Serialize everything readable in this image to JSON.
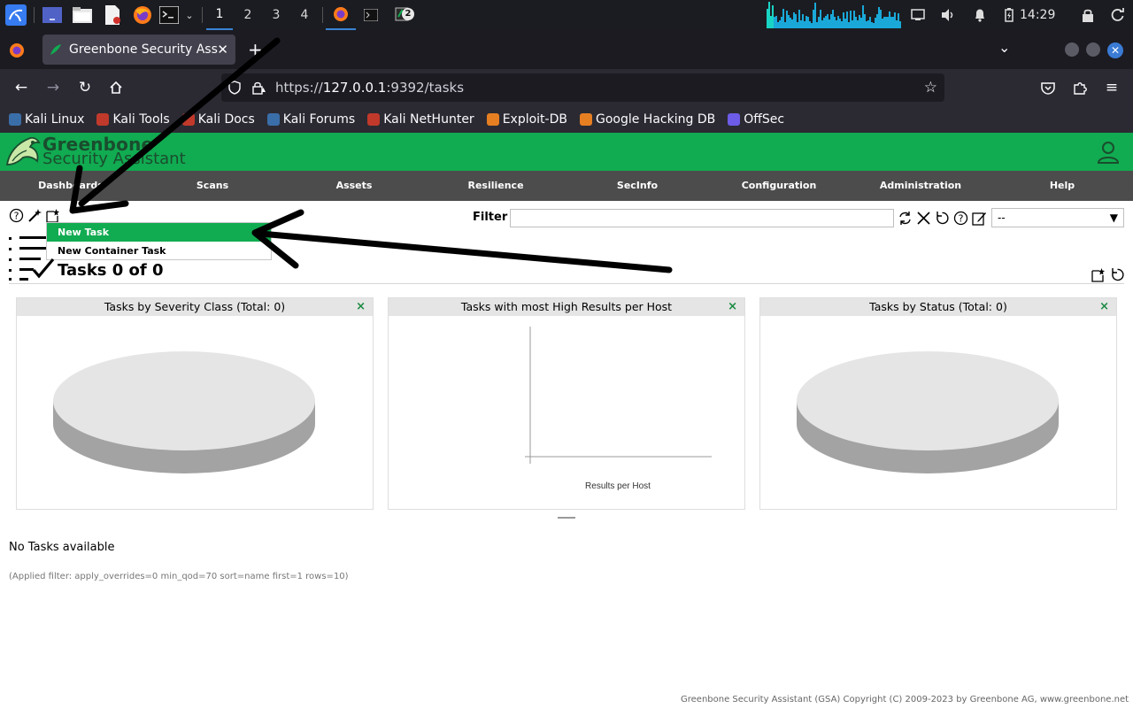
{
  "taskbar": {
    "workspaces": [
      "1",
      "2",
      "3",
      "4"
    ],
    "active_workspace": "1",
    "notification_count": "2",
    "clock": "14:29"
  },
  "browser": {
    "tab_title": "Greenbone Security Assistant",
    "url_prefix": "https://",
    "url_host": "127.0.0.1",
    "url_rest": ":9392/tasks",
    "bookmarks": [
      {
        "label": "Kali Linux",
        "color": "#3a6ea8"
      },
      {
        "label": "Kali Tools",
        "color": "#c0392b"
      },
      {
        "label": "Kali Docs",
        "color": "#c0392b"
      },
      {
        "label": "Kali Forums",
        "color": "#3a6ea8"
      },
      {
        "label": "Kali NetHunter",
        "color": "#c0392b"
      },
      {
        "label": "Exploit-DB",
        "color": "#e67e22"
      },
      {
        "label": "Google Hacking DB",
        "color": "#e67e22"
      },
      {
        "label": "OffSec",
        "color": "#6c5ce7"
      }
    ]
  },
  "gsa": {
    "logo_line1": "Greenbone",
    "logo_line2": "Security Assistant",
    "brand_color": "#11ab51",
    "menu": [
      "Dashboards",
      "Scans",
      "Assets",
      "Resilience",
      "SecInfo",
      "Configuration",
      "Administration",
      "Help"
    ],
    "filter_label": "Filter",
    "filter_value": "",
    "filter_select": "--",
    "new_menu": {
      "items": [
        "New Task",
        "New Container Task"
      ],
      "selected": "New Task"
    },
    "page_title": "Tasks 0 of 0",
    "panels": [
      {
        "title": "Tasks by Severity Class (Total: 0)"
      },
      {
        "title": "Tasks with most High Results per Host",
        "xlabel": "Results per Host"
      },
      {
        "title": "Tasks by Status (Total: 0)"
      }
    ],
    "close_glyph": "×",
    "empty_message": "No Tasks available",
    "applied_filter": "(Applied filter: apply_overrides=0 min_qod=70 sort=name first=1 rows=10)",
    "footer": "Greenbone Security Assistant (GSA) Copyright (C) 2009-2023 by Greenbone AG, www.greenbone.net"
  }
}
